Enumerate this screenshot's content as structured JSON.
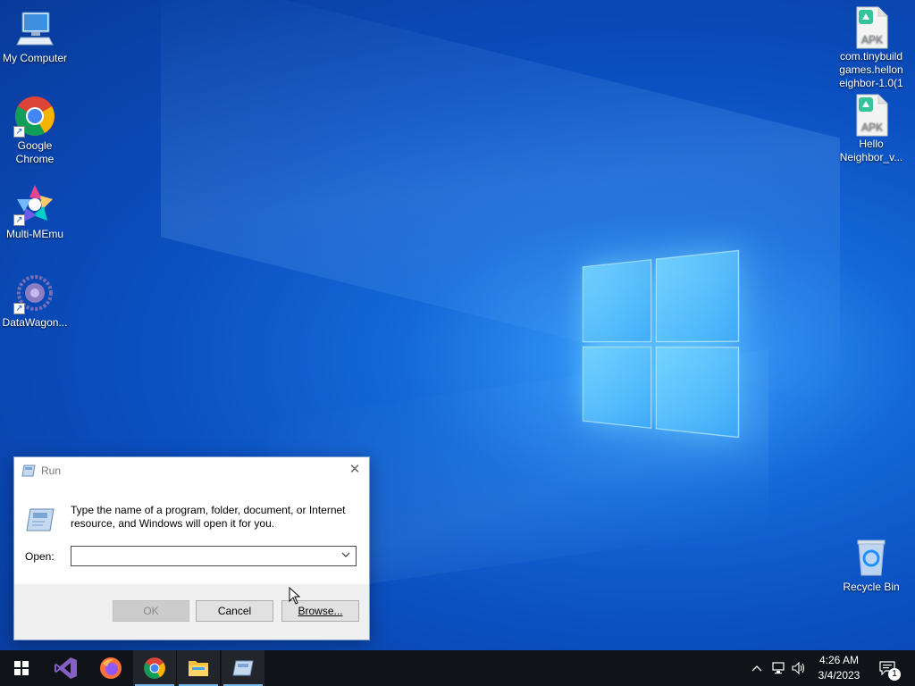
{
  "desktop": {
    "icons_left": [
      {
        "label": "My Computer",
        "icon": "computer-icon"
      },
      {
        "label": "Google Chrome",
        "icon": "chrome-icon"
      },
      {
        "label": "Multi-MEmu",
        "icon": "multi-memu-icon"
      },
      {
        "label": "DataWagon...",
        "icon": "datawagon-icon"
      }
    ],
    "icons_right": [
      {
        "label": "com.tinybuildgames.helloneighbor-1.0(1",
        "line1": "com.tinybuild",
        "line2": "games.hellon",
        "line3": "eighbor-1.0(1",
        "icon": "apk-file-icon",
        "badge": "APK"
      },
      {
        "label": "Hello Neighbor_v...",
        "line1": "Hello",
        "line2": "Neighbor_v...",
        "icon": "apk-file-icon",
        "badge": "APK"
      },
      {
        "label": "Recycle Bin",
        "icon": "recycle-bin-icon"
      }
    ]
  },
  "run_dialog": {
    "title": "Run",
    "close_glyph": "✕",
    "message_line1": "Type the name of a program, folder, document, or Internet",
    "message_line2": "resource, and Windows will open it for you.",
    "open_label": "Open:",
    "open_value": "",
    "ok_label": "OK",
    "cancel_label": "Cancel",
    "browse_label": "Browse..."
  },
  "taskbar": {
    "pinned": [
      "start-icon",
      "visual-studio-icon",
      "firefox-icon",
      "chrome-icon",
      "file-explorer-icon",
      "run-icon"
    ],
    "clock_time": "4:26 AM",
    "clock_date": "3/4/2023",
    "notification_count": "1",
    "tray_chevron": "^"
  },
  "colors": {
    "taskbar_bg": "#101418",
    "accent": "#0078d7",
    "active_indicator": "#76b9ed"
  }
}
